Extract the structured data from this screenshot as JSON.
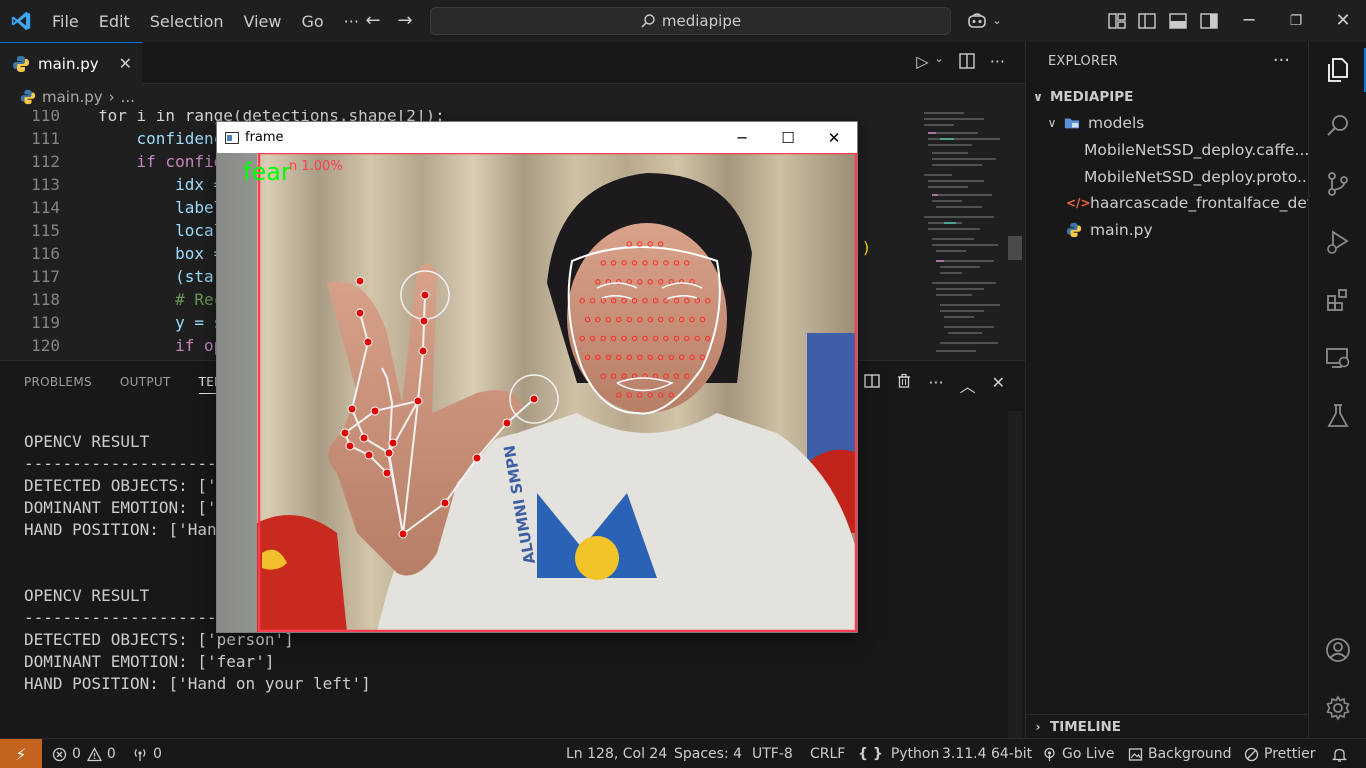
{
  "titlebar": {
    "menu": [
      "File",
      "Edit",
      "Selection",
      "View",
      "Go"
    ],
    "more": "···",
    "search": "mediapipe"
  },
  "tab": {
    "filename": "main.py",
    "close": "✕"
  },
  "breadcrumb": {
    "file": "main.py",
    "rest": "..."
  },
  "editor": {
    "lines": [
      {
        "n": "110",
        "code": "for i in range(detections.shape[2]):"
      },
      {
        "n": "111",
        "code": "    confidence = "
      },
      {
        "n": "112",
        "code": "    if confidence"
      },
      {
        "n": "113",
        "code": "        idx = in"
      },
      {
        "n": "114",
        "code": "        label = "
      },
      {
        "n": "115",
        "code": "        local_de"
      },
      {
        "n": "116",
        "code": "        box = de"
      },
      {
        "n": "117",
        "code": "        (startX,"
      },
      {
        "n": "118",
        "code": "        # Rectan"
      },
      {
        "n": "119",
        "code": "        y = star"
      },
      {
        "n": "120",
        "code": "        if openc"
      }
    ],
    "overflow_bracket": "])"
  },
  "panel": {
    "tabs": [
      "PROBLEMS",
      "OUTPUT",
      "TERMINAL"
    ],
    "terminal_lines": [
      "OPENCV RESULT",
      "--------------------------------",
      "DETECTED OBJECTS: ['person']",
      "DOMINANT EMOTION: ['fear']",
      "HAND POSITION: ['Hand on your left']",
      "",
      "",
      "OPENCV RESULT",
      "--------------------------------",
      "DETECTED OBJECTS: ['person']",
      "DOMINANT EMOTION: ['fear']",
      "HAND POSITION: ['Hand on your left']"
    ]
  },
  "explorer": {
    "title": "EXPLORER",
    "more": "···",
    "root": "MEDIAPIPE",
    "items": [
      {
        "label": "models",
        "kind": "folder"
      },
      {
        "label": "MobileNetSSD_deploy.caffe...",
        "kind": "file"
      },
      {
        "label": "MobileNetSSD_deploy.proto...",
        "kind": "file"
      },
      {
        "label": "haarcascade_frontalface_defa...",
        "kind": "xml"
      },
      {
        "label": "main.py",
        "kind": "python"
      }
    ],
    "timeline": "TIMELINE"
  },
  "frame_window": {
    "title": "frame",
    "emotion_label": "fear",
    "overlay_text": "n 1.00%",
    "colors": {
      "emotion": "#00ff00",
      "box": "#ff3c50",
      "landmark": "#ff0000"
    }
  },
  "statusbar": {
    "errors": "0",
    "warnings": "0",
    "ports": "0",
    "position": "Ln 128, Col 24",
    "spaces": "Spaces: 4",
    "encoding": "UTF-8",
    "eol": "CRLF",
    "language": "Python",
    "interpreter": "3.11.4 64-bit",
    "golive": "Go Live",
    "background": "Background",
    "prettier": "Prettier"
  }
}
